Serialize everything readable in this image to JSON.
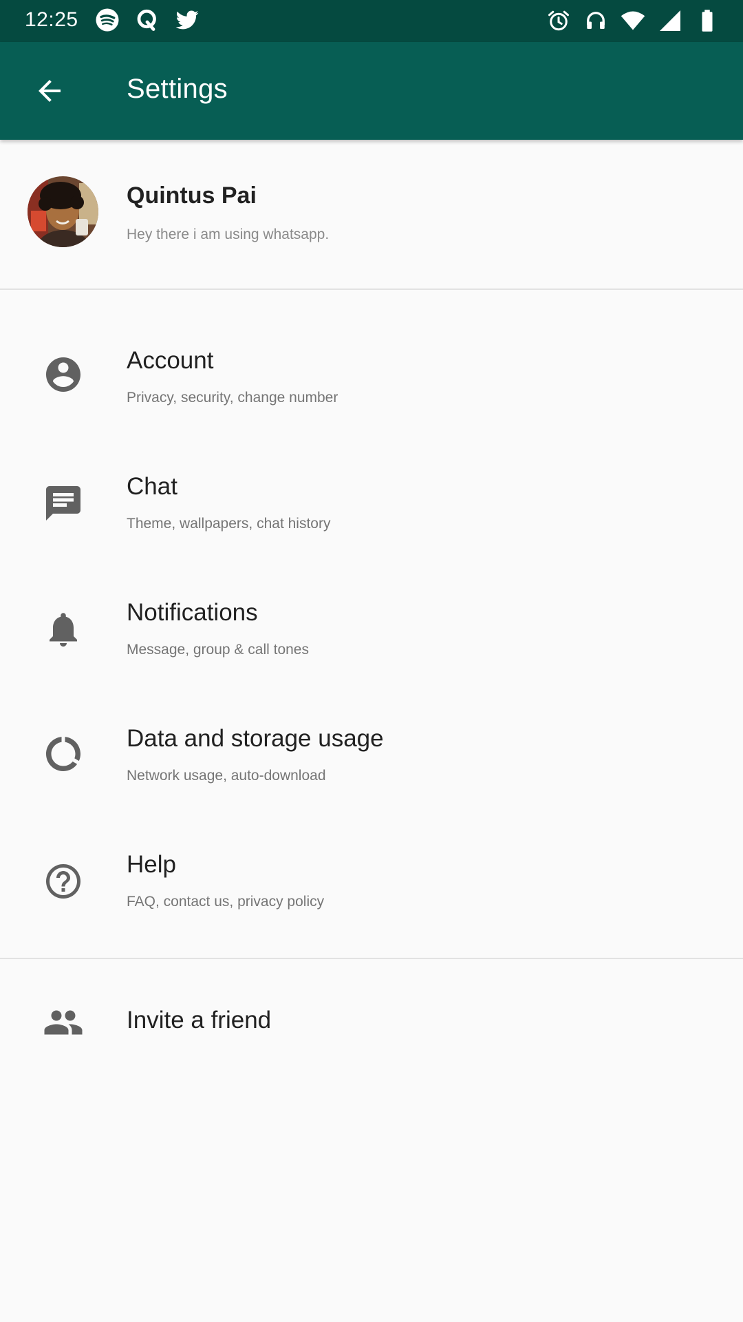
{
  "status_bar": {
    "time": "12:25",
    "left_icons": [
      "spotify-icon",
      "quora-icon",
      "twitter-icon"
    ],
    "right_icons": [
      "alarm-icon",
      "headset-icon",
      "wifi-icon",
      "signal-icon",
      "battery-icon"
    ]
  },
  "app_bar": {
    "back_icon": "arrow-back-icon",
    "title": "Settings"
  },
  "profile": {
    "name": "Quintus Pai",
    "status": "Hey there i am using whatsapp."
  },
  "menu": {
    "items": [
      {
        "icon": "account-icon",
        "title": "Account",
        "subtitle": "Privacy, security, change number"
      },
      {
        "icon": "chat-icon",
        "title": "Chat",
        "subtitle": "Theme, wallpapers, chat history"
      },
      {
        "icon": "bell-icon",
        "title": "Notifications",
        "subtitle": "Message, group & call tones"
      },
      {
        "icon": "data-usage-icon",
        "title": "Data and storage usage",
        "subtitle": "Network usage, auto-download"
      },
      {
        "icon": "help-icon",
        "title": "Help",
        "subtitle": "FAQ, contact us, privacy policy"
      }
    ],
    "invite": {
      "icon": "people-icon",
      "title": "Invite a friend"
    }
  },
  "colors": {
    "status_bar": "#054a40",
    "app_bar": "#075e54",
    "icon_gray": "#616161",
    "background": "#fafafa"
  }
}
